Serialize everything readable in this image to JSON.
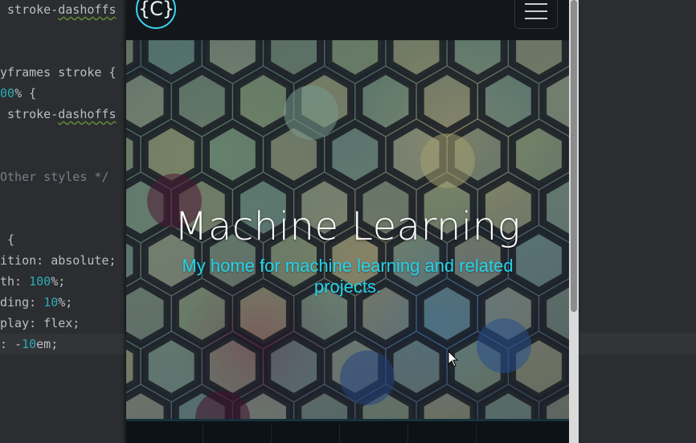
{
  "editor": {
    "lines_left": [
      {
        "parts": [
          {
            "t": " stroke-",
            "c": "t-def"
          },
          {
            "t": "dashoffs",
            "c": "squig"
          }
        ]
      },
      {
        "parts": [
          {
            "t": "",
            "c": "t-def"
          }
        ]
      },
      {
        "parts": [
          {
            "t": "",
            "c": "t-def"
          }
        ]
      },
      {
        "parts": [
          {
            "t": "yframes stroke {",
            "c": "t-def"
          }
        ]
      },
      {
        "parts": [
          {
            "t": "00",
            "c": "t-num"
          },
          {
            "t": "% {",
            "c": "t-def"
          }
        ]
      },
      {
        "parts": [
          {
            "t": " stroke-",
            "c": "t-def"
          },
          {
            "t": "dashoffs",
            "c": "squig"
          }
        ]
      },
      {
        "parts": [
          {
            "t": "",
            "c": "t-def"
          }
        ]
      },
      {
        "parts": [
          {
            "t": "",
            "c": "t-def"
          }
        ]
      },
      {
        "parts": [
          {
            "t": "Other styles */",
            "c": "t-com"
          }
        ]
      },
      {
        "parts": [
          {
            "t": "",
            "c": "t-def"
          }
        ]
      },
      {
        "parts": [
          {
            "t": "",
            "c": "t-def"
          }
        ]
      },
      {
        "parts": [
          {
            "t": " {",
            "c": "t-def"
          }
        ]
      },
      {
        "parts": [
          {
            "t": "ition: absolute;",
            "c": "t-def"
          }
        ]
      },
      {
        "parts": [
          {
            "t": "th: ",
            "c": "t-def"
          },
          {
            "t": "100",
            "c": "t-num"
          },
          {
            "t": "%;",
            "c": "t-def"
          }
        ]
      },
      {
        "parts": [
          {
            "t": "ding: ",
            "c": "t-def"
          },
          {
            "t": "10",
            "c": "t-num"
          },
          {
            "t": "%;",
            "c": "t-def"
          }
        ]
      },
      {
        "parts": [
          {
            "t": "play: flex;",
            "c": "t-def"
          }
        ]
      },
      {
        "parts": [
          {
            "t": ": -",
            "c": "t-def"
          },
          {
            "t": "10",
            "c": "t-num"
          },
          {
            "t": "em;",
            "c": "t-def"
          }
        ]
      }
    ]
  },
  "browser": {
    "logo_text": "{C}",
    "menu_icon": "hamburger-menu-icon",
    "hero": {
      "title": "Machine Learning",
      "subtitle": "My home for machine learning and related projects."
    }
  },
  "colors": {
    "accent": "#24d4ea",
    "editor_bg": "#2b2d30",
    "navbar_bg": "#13171b"
  }
}
